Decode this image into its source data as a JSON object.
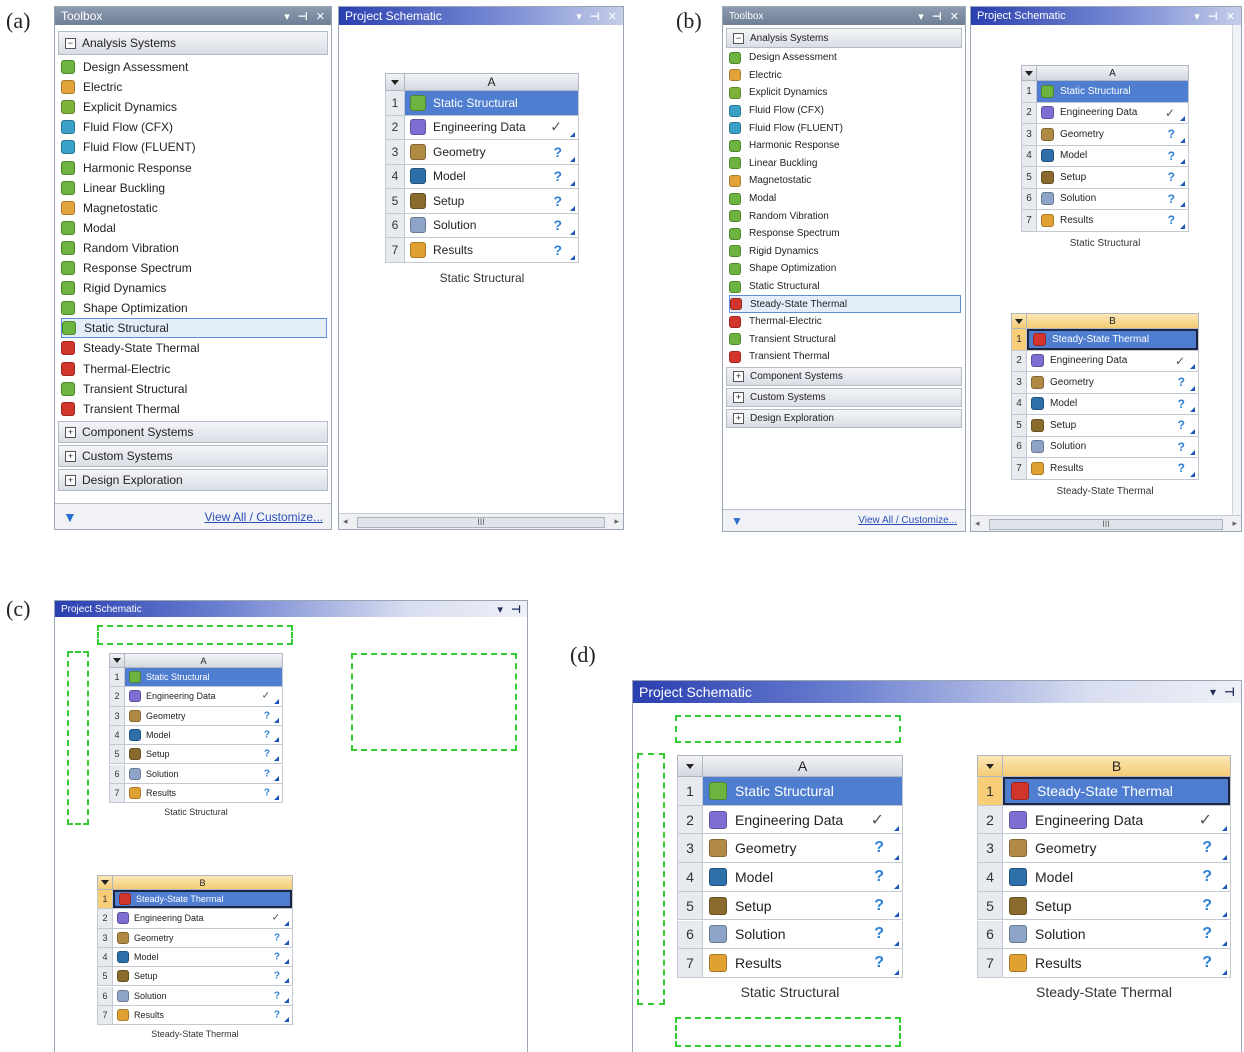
{
  "panel_labels": [
    "(a)",
    "(b)",
    "(c)",
    "(d)"
  ],
  "toolbox": {
    "title": "Toolbox",
    "analysis_header": "Analysis Systems",
    "items_a": [
      "Design Assessment",
      "Electric",
      "Explicit Dynamics",
      "Fluid Flow (CFX)",
      "Fluid Flow (FLUENT)",
      "Harmonic Response",
      "Linear Buckling",
      "Magnetostatic",
      "Modal",
      "Random Vibration",
      "Response Spectrum",
      "Rigid Dynamics",
      "Shape Optimization",
      "Static Structural",
      "Steady-State Thermal",
      "Thermal-Electric",
      "Transient Structural",
      "Transient Thermal"
    ],
    "items_b": [
      "Design Assessment",
      "Electric",
      "Explicit Dynamics",
      "Fluid Flow (CFX)",
      "Fluid Flow (FLUENT)",
      "Harmonic Response",
      "Linear Buckling",
      "Magnetostatic",
      "Modal",
      "Random Vibration",
      "Response Spectrum",
      "Rigid Dynamics",
      "Shape Optimization",
      "Static Structural",
      "Steady-State Thermal",
      "Thermal-Electric",
      "Transient Structural",
      "Transient Thermal"
    ],
    "item_colors": [
      "#6cb33f",
      "#e2a33a",
      "#7fb23a",
      "#3aa0c8",
      "#3aa0c8",
      "#6cb33f",
      "#6cb33f",
      "#e2a33a",
      "#6cb33f",
      "#6cb33f",
      "#6cb33f",
      "#6cb33f",
      "#6cb33f",
      "#6cb33f",
      "#d2352b",
      "#d2352b",
      "#6cb33f",
      "#d2352b"
    ],
    "selected_a": "Static Structural",
    "selected_b": "Steady-State Thermal",
    "categories": [
      "Component Systems",
      "Custom Systems",
      "Design Exploration"
    ],
    "footer_link": "View All / Customize...",
    "filter_icon": "funnel-icon"
  },
  "schematic": {
    "title": "Project Schematic",
    "controls": [
      "▾",
      "⊣",
      "✕"
    ],
    "scroll_mark": "III"
  },
  "systems": {
    "A": {
      "letter": "A",
      "name": "Static Structural",
      "rows": [
        {
          "n": "1",
          "label": "Static Structural",
          "status": "",
          "icon": "#6cb33f"
        },
        {
          "n": "2",
          "label": "Engineering Data",
          "status": "✓",
          "icon": "#7d6fd1"
        },
        {
          "n": "3",
          "label": "Geometry",
          "status": "?",
          "icon": "#b08a45"
        },
        {
          "n": "4",
          "label": "Model",
          "status": "?",
          "icon": "#2d6fa8"
        },
        {
          "n": "5",
          "label": "Setup",
          "status": "?",
          "icon": "#8a6b2d"
        },
        {
          "n": "6",
          "label": "Solution",
          "status": "?",
          "icon": "#8ea3c8"
        },
        {
          "n": "7",
          "label": "Results",
          "status": "?",
          "icon": "#e0a132"
        }
      ]
    },
    "B": {
      "letter": "B",
      "name": "Steady-State Thermal",
      "rows": [
        {
          "n": "1",
          "label": "Steady-State Thermal",
          "status": "",
          "icon": "#d2352b"
        },
        {
          "n": "2",
          "label": "Engineering Data",
          "status": "✓",
          "icon": "#7d6fd1"
        },
        {
          "n": "3",
          "label": "Geometry",
          "status": "?",
          "icon": "#b08a45"
        },
        {
          "n": "4",
          "label": "Model",
          "status": "?",
          "icon": "#2d6fa8"
        },
        {
          "n": "5",
          "label": "Setup",
          "status": "?",
          "icon": "#8a6b2d"
        },
        {
          "n": "6",
          "label": "Solution",
          "status": "?",
          "icon": "#8ea3c8"
        },
        {
          "n": "7",
          "label": "Results",
          "status": "?",
          "icon": "#e0a132"
        }
      ]
    }
  },
  "colors": {
    "selection_blue": "#4f7ed0",
    "drop_target_green": "#33cc33",
    "system_b_header": "#f3cb74"
  }
}
